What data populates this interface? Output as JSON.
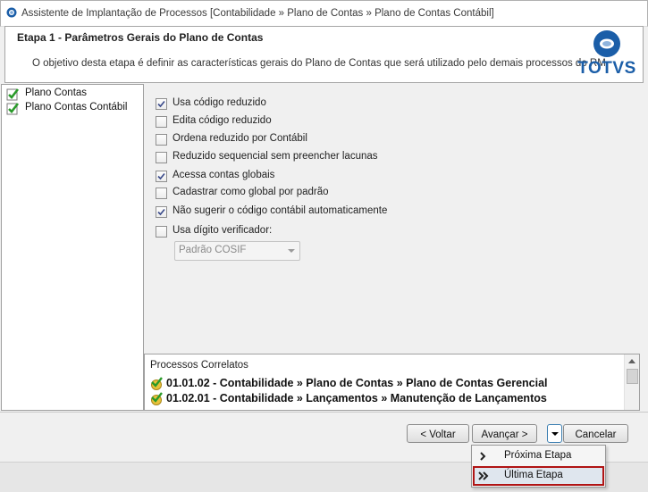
{
  "window": {
    "title": "Assistente de Implantação de Processos [Contabilidade » Plano de Contas » Plano de Contas Contábil]"
  },
  "header": {
    "step_title": "Etapa 1 - Parâmetros Gerais do Plano de Contas",
    "description": "O objetivo desta etapa é definir as características gerais do Plano de Contas que será utilizado pelo demais processos do RM.",
    "logo_text": "TOTVS",
    "logo_color": "#1b5ea8"
  },
  "tree": {
    "items": [
      {
        "label": "Plano Contas",
        "icon": "green-check-icon"
      },
      {
        "label": "Plano Contas Contábil",
        "icon": "green-check-icon"
      }
    ]
  },
  "options": {
    "items": [
      {
        "label": "Usa código reduzido",
        "checked": true
      },
      {
        "label": "Edita código reduzido",
        "checked": false
      },
      {
        "label": "Ordena reduzido por Contábil",
        "checked": false
      },
      {
        "label": "Reduzido sequencial sem preencher lacunas",
        "checked": false
      },
      {
        "label": "Acessa contas globais",
        "checked": true
      },
      {
        "label": "Cadastrar como global por padrão",
        "checked": false
      },
      {
        "label": "Não sugerir o código contábil automaticamente",
        "checked": true
      },
      {
        "label": "Usa dígito verificador:",
        "checked": false
      }
    ],
    "digit_select": {
      "value": "Padrão COSIF",
      "disabled": true
    }
  },
  "correlatos": {
    "title": "Processos Correlatos",
    "items": [
      {
        "text": "01.01.02 - Contabilidade » Plano de Contas » Plano de Contas Gerencial"
      },
      {
        "text": "01.02.01 - Contabilidade » Lançamentos » Manutenção de Lançamentos"
      }
    ]
  },
  "buttons": {
    "voltar": "< Voltar",
    "avancar": "Avançar >",
    "cancelar": "Cancelar"
  },
  "menu": {
    "items": [
      {
        "label": "Próxima Etapa",
        "icon": "single-chevron-right-icon"
      },
      {
        "label": "Última Etapa",
        "icon": "double-chevron-right-icon",
        "highlighted": true
      }
    ]
  },
  "colors": {
    "check_green": "#2a9a2a",
    "highlight_border": "#b01414"
  }
}
